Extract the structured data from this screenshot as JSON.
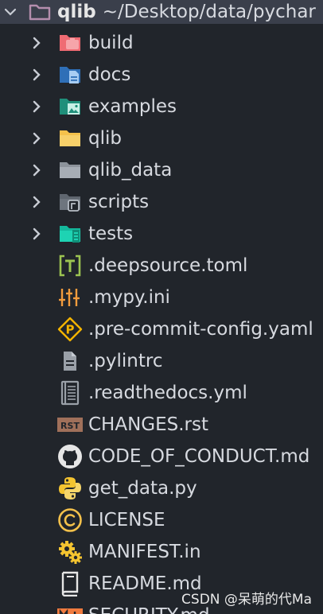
{
  "root": {
    "name": "qlib",
    "path": "~/Desktop/data/pychar"
  },
  "folders": [
    {
      "label": "build",
      "icon": "build-folder-icon",
      "color": "#ef6b73"
    },
    {
      "label": "docs",
      "icon": "docs-folder-icon",
      "color": "#3b86d6"
    },
    {
      "label": "examples",
      "icon": "examples-folder-icon",
      "color": "#1f9f86"
    },
    {
      "label": "qlib",
      "icon": "folder-icon",
      "color": "#f4c14b"
    },
    {
      "label": "qlib_data",
      "icon": "folder-icon",
      "color": "#9aa0a8"
    },
    {
      "label": "scripts",
      "icon": "scripts-folder-icon",
      "color": "#9aa0a8"
    },
    {
      "label": "tests",
      "icon": "tests-folder-icon",
      "color": "#1ed3b3"
    }
  ],
  "files": [
    {
      "label": ".deepsource.toml",
      "icon": "toml-icon",
      "color": "#9cc451"
    },
    {
      "label": ".mypy.ini",
      "icon": "settings-sliders-icon",
      "color": "#f39c3d"
    },
    {
      "label": ".pre-commit-config.yaml",
      "icon": "pre-commit-icon",
      "color": "#f4b400"
    },
    {
      "label": ".pylintrc",
      "icon": "document-icon",
      "color": "#9aa0a8"
    },
    {
      "label": ".readthedocs.yml",
      "icon": "readthedocs-book-icon",
      "color": "#9aa0a8"
    },
    {
      "label": "CHANGES.rst",
      "icon": "rst-icon",
      "color": "#a0705a"
    },
    {
      "label": "CODE_OF_CONDUCT.md",
      "icon": "github-icon",
      "color": "#e6e6e6"
    },
    {
      "label": "get_data.py",
      "icon": "python-icon",
      "color": "#f4c430"
    },
    {
      "label": "LICENSE",
      "icon": "copyright-icon",
      "color": "#f4c14b"
    },
    {
      "label": "MANIFEST.in",
      "icon": "manifest-gears-icon",
      "color": "#f4c430"
    },
    {
      "label": "README.md",
      "icon": "readme-book-icon",
      "color": "#e6e6e6"
    },
    {
      "label": "SECURITY.md",
      "icon": "markdown-icon",
      "color": "#f07b3f"
    }
  ],
  "watermark": "CSDN @呆萌的代Ma"
}
